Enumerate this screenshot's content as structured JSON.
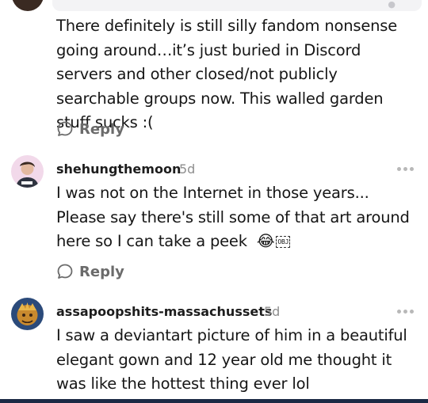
{
  "comments": [
    {
      "body": "There definitely is still silly fandom nonsense going around…it’s just buried in Discord servers and other closed/not publicly searchable groups now.  This walled garden stuff sucks :(",
      "reply_label": "Reply"
    },
    {
      "username": "shehungthemoon",
      "time": "5d",
      "body": "I was not on the Internet in those years... Please say there's still some of that art around here so I can take a peek",
      "emoji": "😂",
      "obj_label": "OBJ",
      "reply_label": "Reply"
    },
    {
      "username": "assapoopshits-massachussets",
      "time": "5d",
      "body": "I saw a deviantart picture of him in a beautiful elegant gown and 12 year old me thought it was like the hottest thing ever lol"
    }
  ],
  "icons": {
    "reply": "speech-bubble-icon",
    "more": "more-dots-icon"
  },
  "colors": {
    "text": "#161616",
    "muted": "#8e8e8e",
    "reply": "#6b6b6b",
    "bottom_bar": "#1b2a45"
  }
}
